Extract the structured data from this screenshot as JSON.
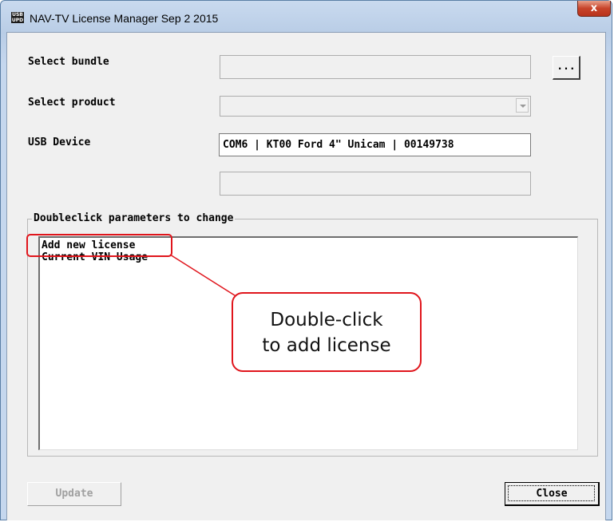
{
  "window": {
    "title": "NAV-TV License Manager  Sep  2 2015",
    "icon_text_top": "USB",
    "icon_text_bottom": "UPD",
    "close_glyph": "x"
  },
  "form": {
    "bundle_label": "Select bundle",
    "bundle_value": "",
    "browse_button": "...",
    "product_label": "Select product",
    "product_value": "",
    "usb_label": "USB Device",
    "usb_value": "COM6 | KT00 Ford 4\" Unicam | 00149738",
    "extra_value": ""
  },
  "parameters": {
    "group_label": "Doubleclick parameters to change",
    "items": [
      {
        "label": "Add new license"
      },
      {
        "label": "Current VIN Usage"
      }
    ]
  },
  "annotation": {
    "line1": "Double-click",
    "line2": "to add license",
    "color": "#e0151c"
  },
  "buttons": {
    "update": "Update",
    "close": "Close"
  }
}
